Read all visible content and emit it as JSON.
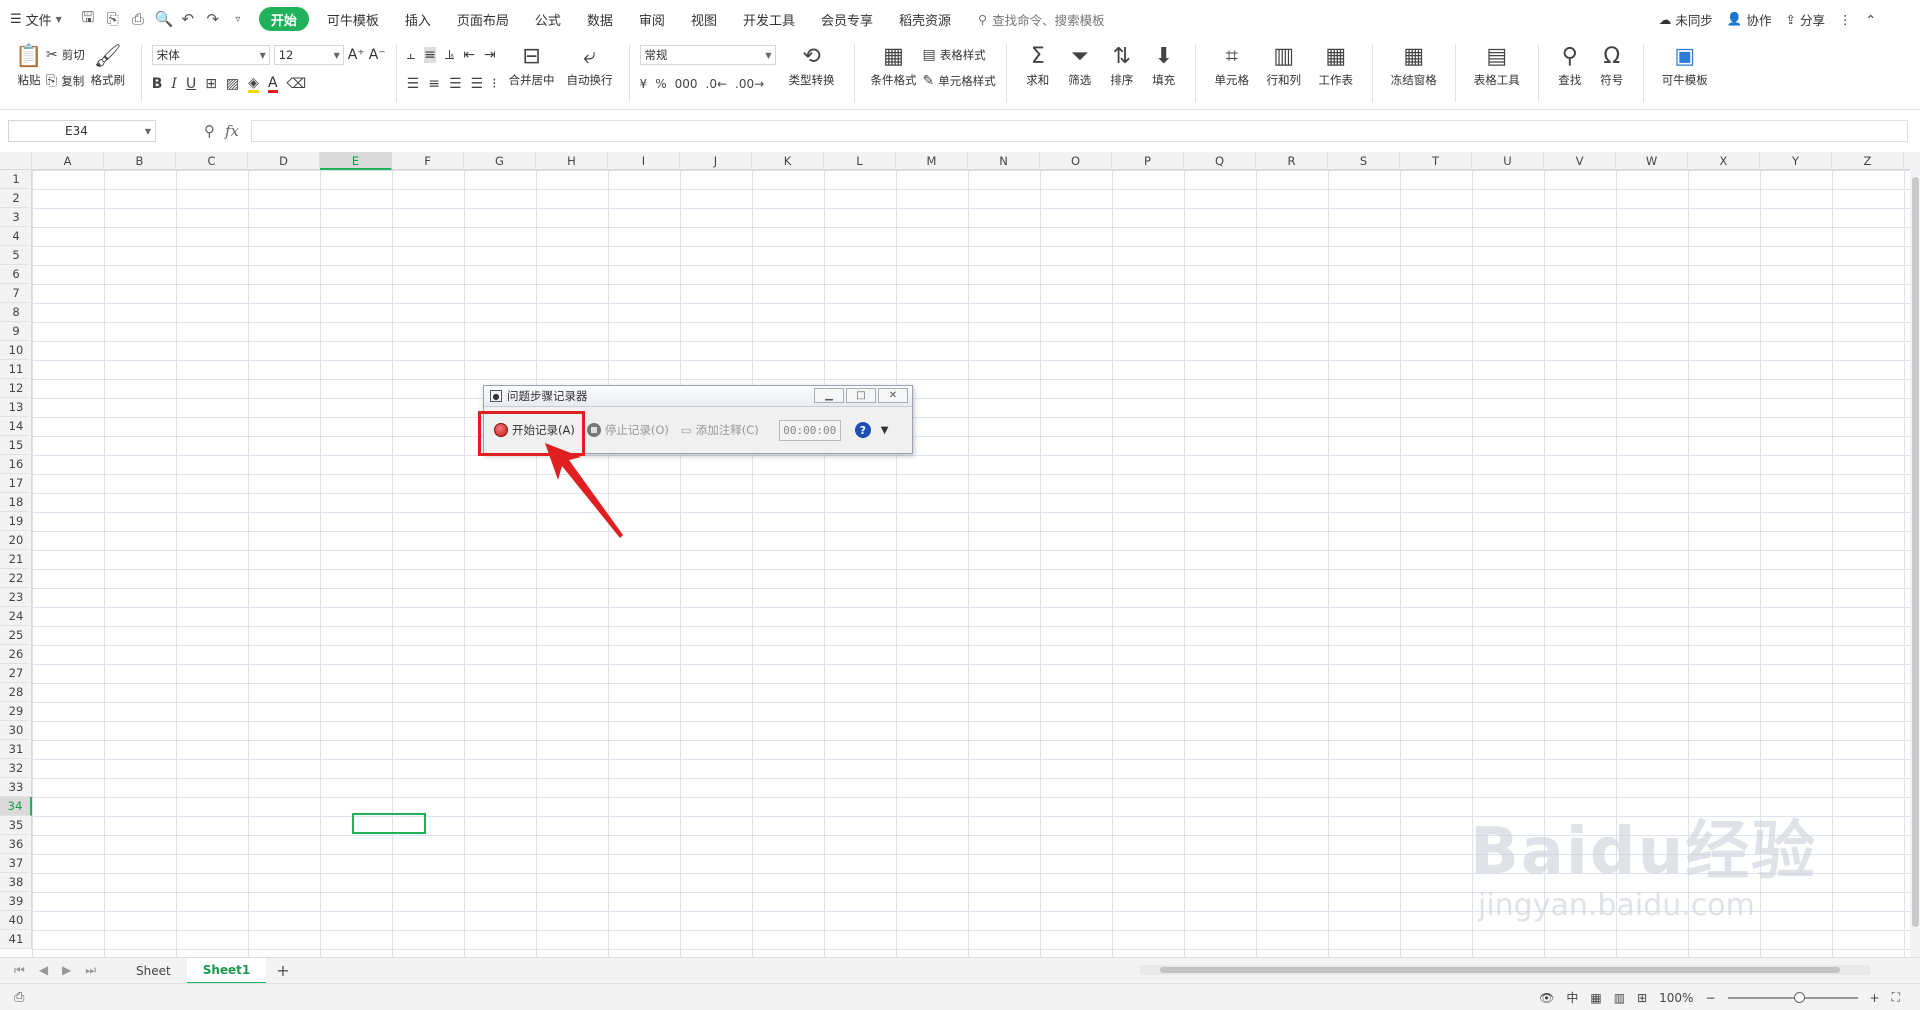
{
  "menu": {
    "file": "文件",
    "tabs": [
      "开始",
      "可牛模板",
      "插入",
      "页面布局",
      "公式",
      "数据",
      "审阅",
      "视图",
      "开发工具",
      "会员专享",
      "稻壳资源"
    ],
    "search": "查找命令、搜索模板",
    "sync": "未同步",
    "collab": "协作",
    "share": "分享"
  },
  "toolbar": {
    "paste": "粘贴",
    "cut": "剪切",
    "copy": "复制",
    "format_painter": "格式刷",
    "font": "宋体",
    "font_size": "12",
    "merge_center": "合并居中",
    "wrap": "自动换行",
    "number_format": "常规",
    "currency": "¥",
    "percent": "%",
    "type_convert": "类型转换",
    "cond_format": "条件格式",
    "table_style": "表格样式",
    "cell_style": "单元格样式",
    "sum": "求和",
    "filter": "筛选",
    "sort": "排序",
    "fill": "填充",
    "cells": "单元格",
    "rows_cols": "行和列",
    "worksheet": "工作表",
    "freeze": "冻结窗格",
    "table_tools": "表格工具",
    "find": "查找",
    "symbol": "符号",
    "kn_template": "可牛模板"
  },
  "formula": {
    "name_box": "E34",
    "fx": "fx"
  },
  "columns": [
    "A",
    "B",
    "C",
    "D",
    "E",
    "F",
    "G",
    "H",
    "I",
    "J",
    "K",
    "L",
    "M",
    "N",
    "O",
    "P",
    "Q",
    "R",
    "S",
    "T",
    "U",
    "V",
    "W",
    "X",
    "Y",
    "Z"
  ],
  "rows": [
    "1",
    "2",
    "3",
    "4",
    "5",
    "6",
    "7",
    "8",
    "9",
    "10",
    "11",
    "12",
    "13",
    "14",
    "15",
    "16",
    "17",
    "18",
    "19",
    "20",
    "21",
    "22",
    "23",
    "24",
    "25",
    "26",
    "27",
    "28",
    "29",
    "30",
    "31",
    "32",
    "33",
    "34",
    "35",
    "36",
    "37",
    "38",
    "39",
    "40",
    "41"
  ],
  "selected_col": "E",
  "selected_row": "34",
  "sheets": {
    "tabs": [
      "Sheet",
      "Sheet1"
    ],
    "active": "Sheet1",
    "add": "+"
  },
  "status": {
    "zoom": "100%",
    "lang": "中"
  },
  "recorder": {
    "title": "问题步骤记录器",
    "start": "开始记录(A)",
    "stop": "停止记录(O)",
    "comment": "添加注释(C)",
    "timer": "00:00:00",
    "help": "?"
  },
  "watermark": {
    "brand": "Baidu经验",
    "url": "jingyan.baidu.com"
  },
  "colors": {
    "accent": "#1fb25a",
    "highlight": "#e02020"
  }
}
